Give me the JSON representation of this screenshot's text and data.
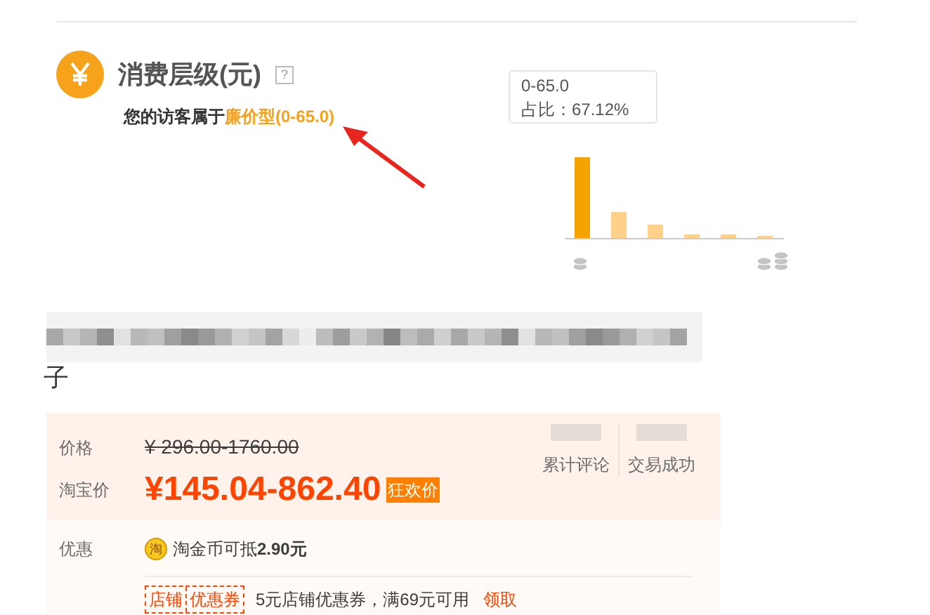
{
  "consumption": {
    "title": "消费层级(元)",
    "help": "?",
    "summary_prefix": "您的访客属于",
    "summary_highlight": "廉价型(0-65.0)"
  },
  "chart_tooltip": {
    "range": "0-65.0",
    "share": "占比：67.12%"
  },
  "product": {
    "title_tail": "子"
  },
  "price": {
    "label": "价格",
    "original": "¥ 296.00-1760.00",
    "tb_label": "淘宝价",
    "currency": "¥",
    "current": "145.04-862.40",
    "badge": "狂欢价",
    "stats": [
      {
        "label": "累计评论"
      },
      {
        "label": "交易成功"
      }
    ],
    "promo_label": "优惠",
    "coin_icon": "淘",
    "coin_prefix": "淘金币可抵",
    "coin_amount": "2.90元",
    "coupon_tags": [
      "店铺",
      "优惠券"
    ],
    "coupon_text": "5元店铺优惠券，满69元可用",
    "coupon_link": "领取"
  }
}
